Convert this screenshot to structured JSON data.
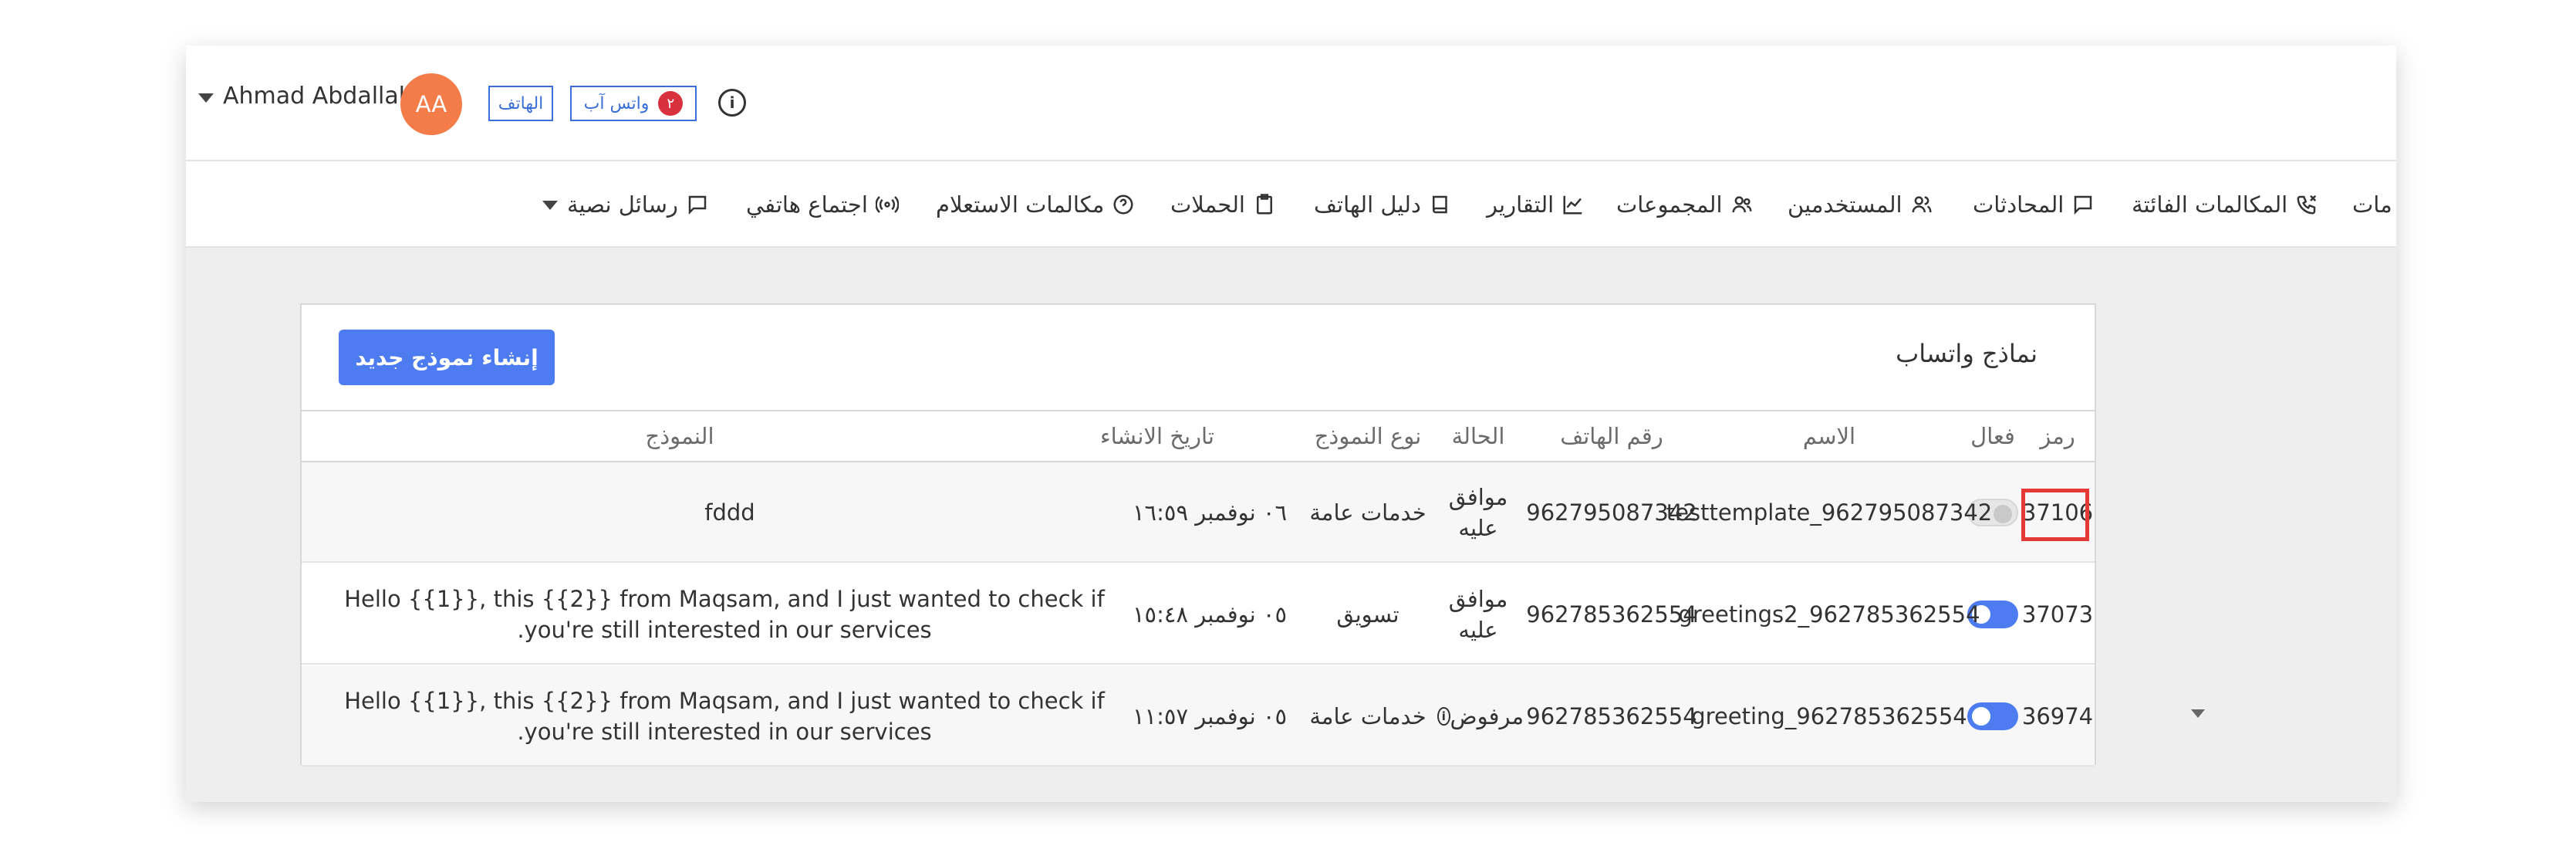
{
  "header": {
    "user_name": "Ahmad Abdallah",
    "avatar_initials": "AA",
    "phone_badge": "الهاتف",
    "whatsapp_badge": "واتس آب",
    "whatsapp_count": "٢",
    "info_icon": "i"
  },
  "nav": {
    "cut_item": "مات",
    "missed_calls": "المكالمات الفائتة",
    "conversations": "المحادثات",
    "users": "المستخدمين",
    "groups": "المجموعات",
    "reports": "التقارير",
    "phonebook": "دليل الهاتف",
    "campaigns": "الحملات",
    "inquiry_calls": "مكالمات الاستعلام",
    "conference": "اجتماع هاتفي",
    "sms": "رسائل نصية"
  },
  "card": {
    "title": "نماذج واتساب",
    "create_button": "إنشاء نموذج جديد"
  },
  "table": {
    "headers": {
      "code": "رمز",
      "active": "فعال",
      "name": "الاسم",
      "phone": "رقم الهاتف",
      "status": "الحالة",
      "type": "نوع النموذج",
      "created": "تاريخ الانشاء",
      "template": "النموذج"
    },
    "rows": [
      {
        "code": "37106",
        "active": false,
        "name": "testtemplate_962795087342",
        "phone": "962795087342",
        "status": "موافق عليه",
        "type": "خدمات عامة",
        "created": "٠٦ نوفمبر ١٦:٥٩",
        "template_line1": "fddd",
        "template_line2": ""
      },
      {
        "code": "37073",
        "active": true,
        "name": "greetings2_962785362554",
        "phone": "962785362554",
        "status": "موافق عليه",
        "type": "تسويق",
        "created": "٠٥ نوفمبر ١٥:٤٨",
        "template_line1": "Hello {{1}}, this {{2}} from Maqsam, and I just wanted to check if",
        "template_line2": ".you're still interested in our services"
      },
      {
        "code": "36974",
        "active": true,
        "name": "greeting_962785362554",
        "phone": "962785362554",
        "status": "مرفوض",
        "type": "خدمات عامة",
        "created": "٠٥ نوفمبر ١١:٥٧",
        "template_line1": "Hello {{1}}, this {{2}} from Maqsam, and I just wanted to check if",
        "template_line2": ".you're still interested in our services"
      }
    ]
  },
  "colors": {
    "accent": "#4d7cf0",
    "avatar": "#f47c48",
    "badge_red": "#d9303e",
    "highlight": "#e53935"
  },
  "icons": [
    "caret-down-icon",
    "info-icon",
    "missed-call-icon",
    "chat-icon",
    "users-icon",
    "groups-icon",
    "chart-icon",
    "book-icon",
    "clipboard-icon",
    "question-icon",
    "broadcast-icon",
    "message-icon"
  ]
}
